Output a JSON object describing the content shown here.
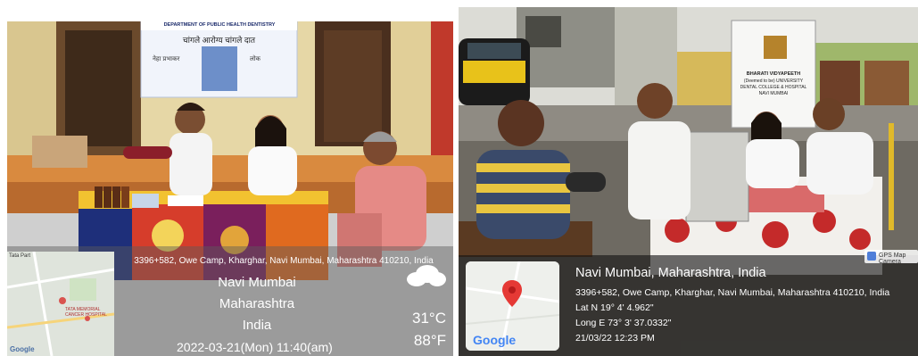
{
  "left_photo": {
    "banner_header": "DEPARTMENT OF PUBLIC HEALTH DENTISTRY",
    "banner_line1": "चांगले आरोग्य चांगले दात",
    "banner_line2a": "नेहा प्रभाकर",
    "banner_line2b": "लोक",
    "map_label_top": "Tata Part",
    "map_label_hospital": "TATA MEMORIAL CANCER HOSPITAL",
    "map_google": "Google",
    "address": "3396+582, Owe Camp, Kharghar, Navi Mumbai, Maharashtra 410210, India",
    "city": "Navi Mumbai",
    "state": "Maharashtra",
    "country": "India",
    "temp_c": "31°C",
    "temp_f": "88°F",
    "datetime": "2022-03-21(Mon)  11:40(am)"
  },
  "right_photo": {
    "banner_line1": "BHARATI VIDYAPEETH",
    "banner_line2": "(Deemed to be) UNIVERSITY",
    "banner_line3": "DENTAL COLLEGE & HOSPITAL",
    "banner_line4": "NAVI MUMBAI",
    "badge": "GPS Map Camera",
    "map_google": "Google",
    "title": "Navi Mumbai, Maharashtra, India",
    "address": "3396+582, Owe Camp, Kharghar, Navi Mumbai, Maharashtra 410210, India",
    "lat": "Lat N 19° 4' 4.962\"",
    "long": "Long E 73° 3' 37.0332\"",
    "datetime": "21/03/22 12:23 PM"
  }
}
